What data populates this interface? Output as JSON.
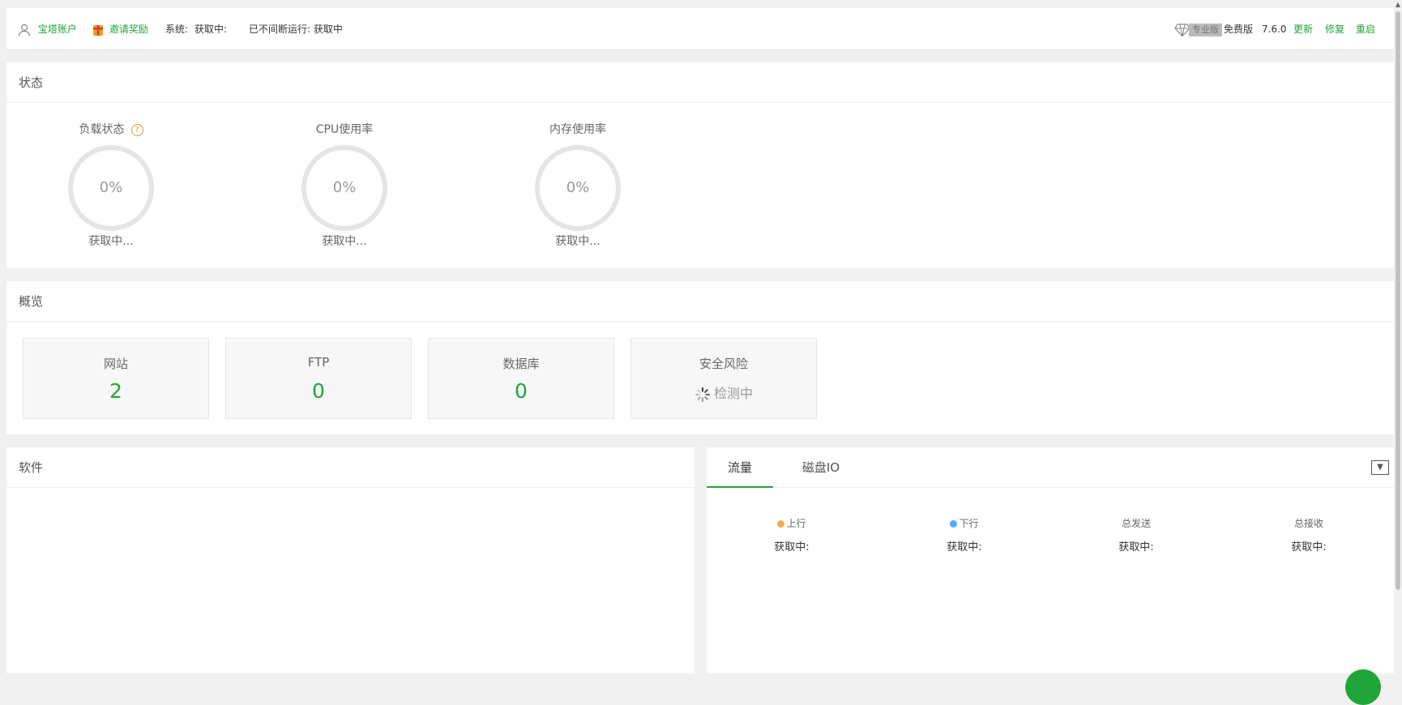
{
  "topbar": {
    "account_label": "宝塔账户",
    "invite_label": "邀请奖励",
    "system_prefix": "系统:",
    "system_value": "获取中:",
    "uptime_label": "已不间断运行: 获取中",
    "pro_badge": "专业版",
    "edition": "免费版",
    "version": "7.6.0",
    "update_label": "更新",
    "repair_label": "修复",
    "restart_label": "重启"
  },
  "status": {
    "title": "状态",
    "gauges": [
      {
        "title": "负载状态",
        "value": "0%",
        "sub": "获取中..."
      },
      {
        "title": "CPU使用率",
        "value": "0%",
        "sub": "获取中..."
      },
      {
        "title": "内存使用率",
        "value": "0%",
        "sub": "获取中..."
      }
    ]
  },
  "overview": {
    "title": "概览",
    "cards": [
      {
        "label": "网站",
        "value": "2"
      },
      {
        "label": "FTP",
        "value": "0"
      },
      {
        "label": "数据库",
        "value": "0"
      },
      {
        "label": "安全风险",
        "value": "检测中"
      }
    ]
  },
  "software": {
    "title": "软件"
  },
  "traffic": {
    "tabs": [
      "流量",
      "磁盘IO"
    ],
    "stats": [
      {
        "label": "上行",
        "value": "获取中:",
        "dot_color": "#f0ad4e"
      },
      {
        "label": "下行",
        "value": "获取中:",
        "dot_color": "#52a9ff"
      },
      {
        "label": "总发送",
        "value": "获取中:"
      },
      {
        "label": "总接收",
        "value": "获取中:"
      }
    ]
  },
  "colors": {
    "accent": "#20a53a",
    "help": "#d99a2b"
  }
}
